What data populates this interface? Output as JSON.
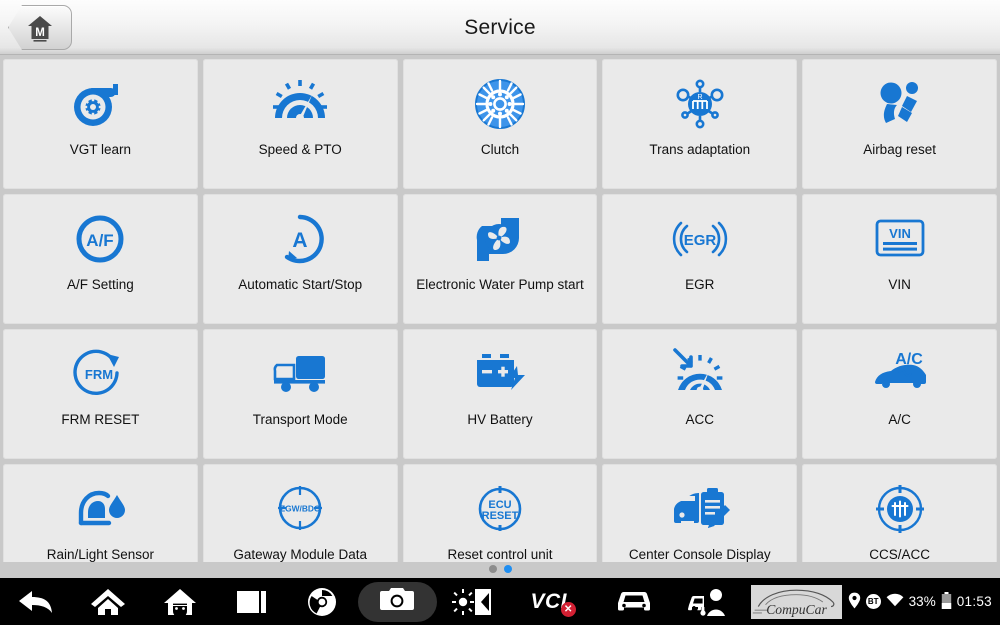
{
  "header": {
    "title": "Service",
    "home_button_label": "M",
    "home_icon": "house-m-icon"
  },
  "grid": {
    "tiles": [
      {
        "label": "VGT learn",
        "icon": "turbocharger-icon"
      },
      {
        "label": "Speed & PTO",
        "icon": "speedometer-icon"
      },
      {
        "label": "Clutch",
        "icon": "clutch-disc-icon"
      },
      {
        "label": "Trans adaptation",
        "icon": "transmission-gear-icon"
      },
      {
        "label": "Airbag reset",
        "icon": "airbag-occupant-icon"
      },
      {
        "label": "A/F Setting",
        "icon": "af-circle-icon"
      },
      {
        "label": "Automatic Start/Stop",
        "icon": "auto-start-stop-icon"
      },
      {
        "label": "Electronic Water Pump start",
        "icon": "water-pump-icon"
      },
      {
        "label": "EGR",
        "icon": "egr-icon"
      },
      {
        "label": "VIN",
        "icon": "vin-plate-icon"
      },
      {
        "label": "FRM RESET",
        "icon": "frm-reset-icon"
      },
      {
        "label": "Transport Mode",
        "icon": "truck-icon"
      },
      {
        "label": "HV Battery",
        "icon": "hv-battery-icon"
      },
      {
        "label": "ACC",
        "icon": "acc-gauge-icon"
      },
      {
        "label": "A/C",
        "icon": "ac-car-icon"
      },
      {
        "label": "Rain/Light Sensor",
        "icon": "rain-light-sensor-icon"
      },
      {
        "label": "Gateway Module Data Calibration",
        "icon": "zgw-bdc-icon"
      },
      {
        "label": "Reset control unit",
        "icon": "ecu-reset-icon"
      },
      {
        "label": "Center Console Display Service History",
        "icon": "car-clipboard-icon"
      },
      {
        "label": "CCS/ACC",
        "icon": "ccs-acc-radar-icon"
      }
    ],
    "icon_texts": {
      "af": "A/F",
      "auto": "A",
      "egr": "EGR",
      "vin": "VIN",
      "frm": "FRM",
      "zgw": "ZGW/BDC",
      "ecu_line1": "ECU",
      "ecu_line2": "RESET",
      "ac": "A/C"
    }
  },
  "pager": {
    "dots": [
      {
        "state": "inactive"
      },
      {
        "state": "active"
      }
    ]
  },
  "navbar": {
    "items": [
      {
        "name": "back",
        "icon": "back-arrow-icon"
      },
      {
        "name": "home",
        "icon": "home-icon"
      },
      {
        "name": "android-home",
        "icon": "android-house-icon"
      },
      {
        "name": "recents",
        "icon": "recents-square-icon"
      },
      {
        "name": "browser",
        "icon": "chrome-browser-icon"
      },
      {
        "name": "camera",
        "icon": "camera-icon"
      },
      {
        "name": "display",
        "icon": "brightness-volume-icon"
      },
      {
        "name": "vci",
        "icon": "vci-icon"
      },
      {
        "name": "vehicle",
        "icon": "car-icon"
      },
      {
        "name": "technician",
        "icon": "car-technician-icon"
      }
    ],
    "vci_label": "VCI",
    "vci_badge": "✕",
    "logo_text": "CompuCar",
    "status": {
      "location_icon": "location-pin-icon",
      "bluetooth_label": "BT",
      "wifi_icon": "wifi-icon",
      "battery_percent": "33%",
      "battery_icon": "battery-icon",
      "clock": "01:53"
    }
  },
  "colors": {
    "accent_blue": "#1877d2",
    "accent_blue_light": "#3d94ea",
    "tile_bg": "#eaeaea",
    "grid_bg": "#c9c9c9",
    "navbar_bg": "#000000",
    "badge_red": "#d32033"
  }
}
